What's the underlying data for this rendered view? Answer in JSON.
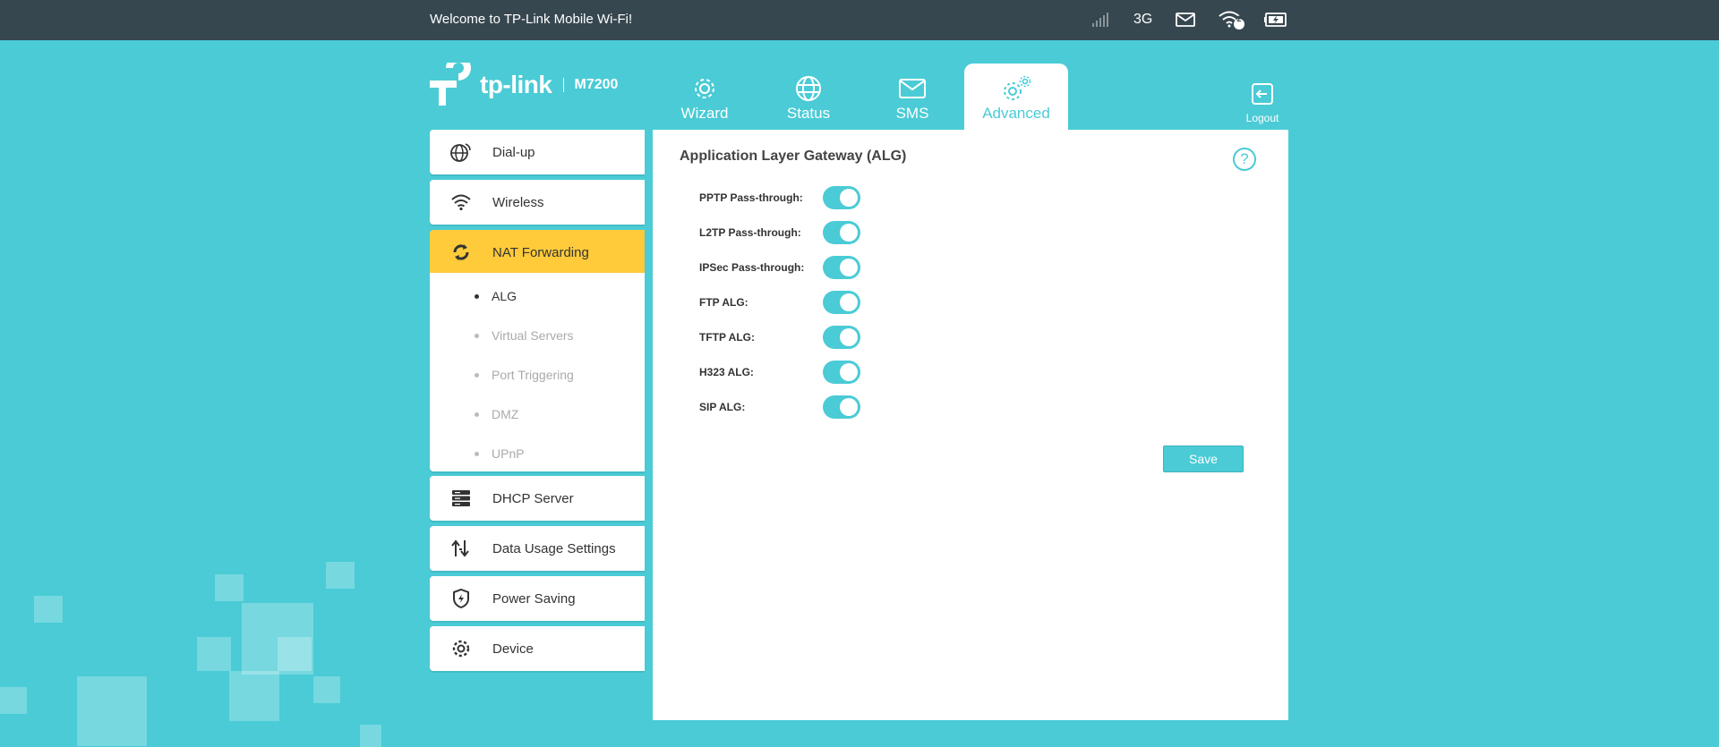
{
  "topbar": {
    "welcome": "Welcome to TP-Link Mobile Wi-Fi!",
    "network_type": "3G",
    "wifi_clients": "2",
    "icons": [
      "signal-icon",
      "mail-icon",
      "wifi-icon",
      "battery-charging-icon"
    ]
  },
  "brand": {
    "name": "tp-link",
    "model": "M7200"
  },
  "tabs": [
    {
      "label": "Wizard",
      "icon": "gear-icon"
    },
    {
      "label": "Status",
      "icon": "globe-icon"
    },
    {
      "label": "SMS",
      "icon": "envelope-icon"
    },
    {
      "label": "Advanced",
      "icon": "gears-icon",
      "active": true
    }
  ],
  "logout": {
    "label": "Logout"
  },
  "sidebar": {
    "items": [
      {
        "label": "Dial-up",
        "icon": "globe-dial-icon"
      },
      {
        "label": "Wireless",
        "icon": "wifi-icon"
      },
      {
        "label": "NAT Forwarding",
        "icon": "nat-icon",
        "active": true
      },
      {
        "label": "DHCP Server",
        "icon": "server-icon"
      },
      {
        "label": "Data Usage Settings",
        "icon": "data-usage-icon"
      },
      {
        "label": "Power Saving",
        "icon": "shield-power-icon"
      },
      {
        "label": "Device",
        "icon": "gear-icon"
      }
    ],
    "sub_items": [
      {
        "label": "ALG",
        "active": true
      },
      {
        "label": "Virtual Servers"
      },
      {
        "label": "Port Triggering"
      },
      {
        "label": "DMZ"
      },
      {
        "label": "UPnP"
      }
    ]
  },
  "main": {
    "title": "Application Layer Gateway (ALG)",
    "help": "?",
    "settings": [
      {
        "label": "PPTP Pass-through:",
        "enabled": true
      },
      {
        "label": "L2TP Pass-through:",
        "enabled": true
      },
      {
        "label": "IPSec Pass-through:",
        "enabled": true
      },
      {
        "label": "FTP ALG:",
        "enabled": true
      },
      {
        "label": "TFTP ALG:",
        "enabled": true
      },
      {
        "label": "H323 ALG:",
        "enabled": true
      },
      {
        "label": "SIP ALG:",
        "enabled": true
      }
    ],
    "save_label": "Save"
  },
  "colors": {
    "background": "#4acbd6",
    "topbar": "#37474f",
    "accent": "#4acbd6",
    "active_item": "#ffcb3b"
  }
}
